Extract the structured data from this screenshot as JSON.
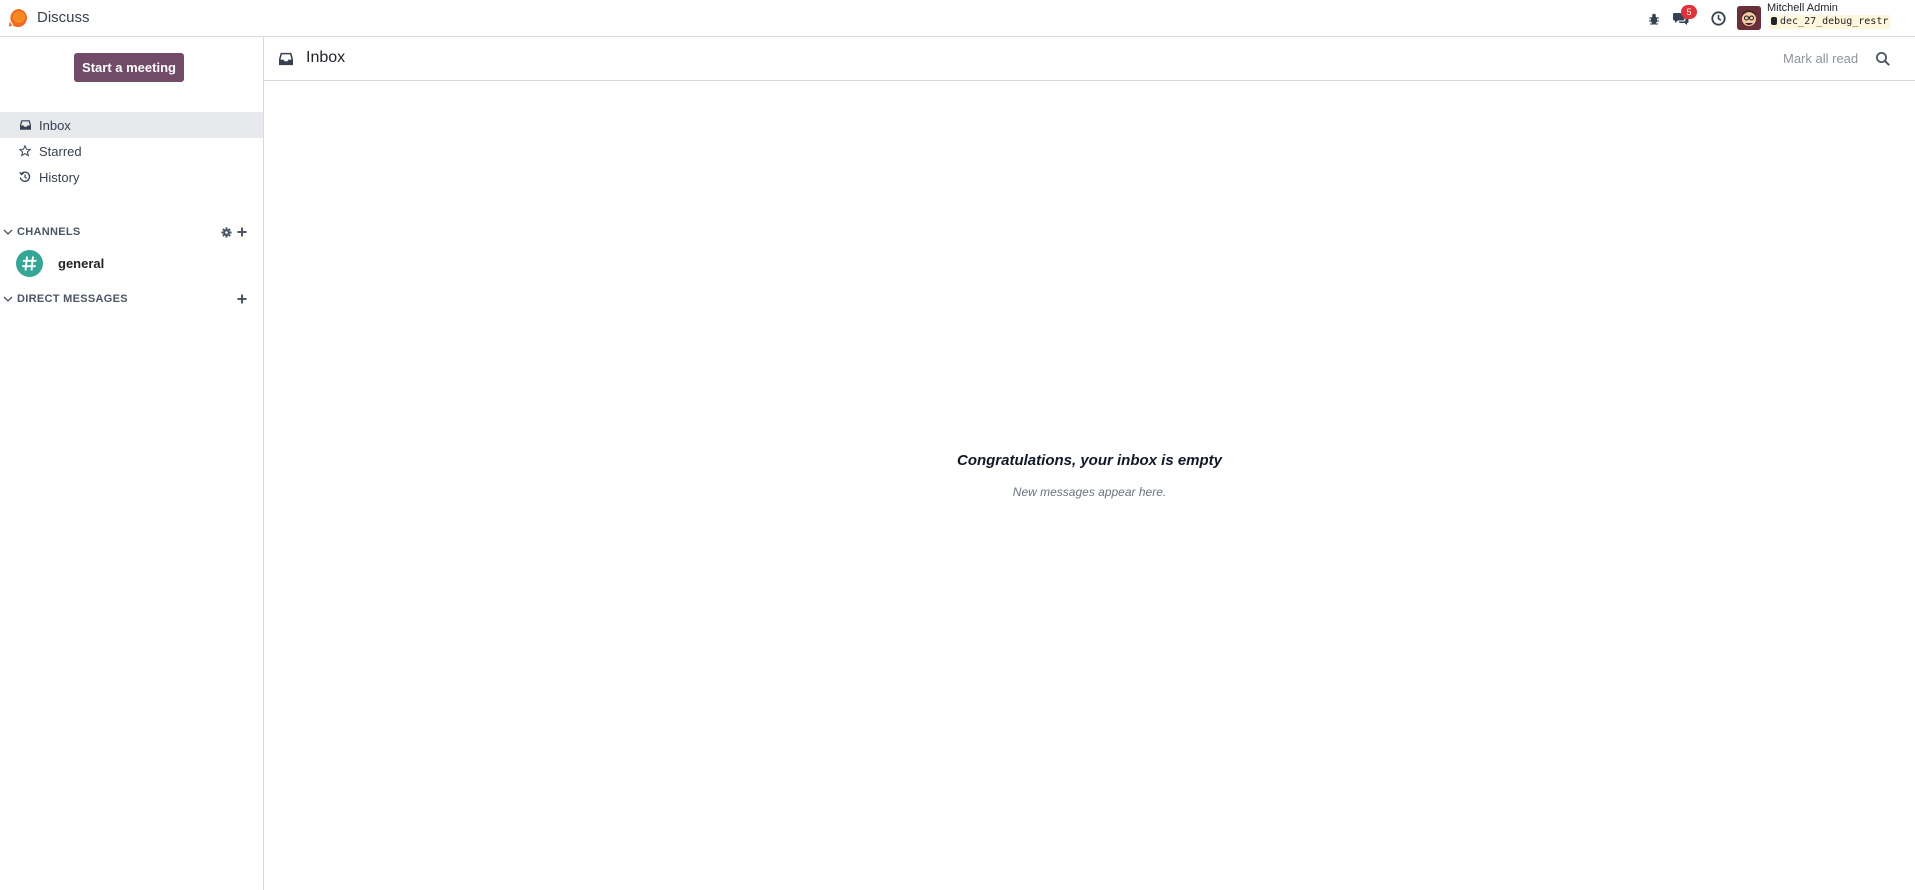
{
  "navbar": {
    "app_name": "Discuss",
    "app_logo_icon": "odoo-discuss-logo-icon",
    "messaging_badge": "5",
    "user_name": "Mitchell Admin",
    "database": "dec_27_debug_restr"
  },
  "sidebar": {
    "start_meeting_label": "Start a meeting",
    "mailboxes": [
      {
        "label": "Inbox",
        "icon": "inbox-icon",
        "active": true
      },
      {
        "label": "Starred",
        "icon": "star-icon",
        "active": false
      },
      {
        "label": "History",
        "icon": "history-icon",
        "active": false
      }
    ],
    "channels_header": "CHANNELS",
    "channels": [
      {
        "name": "general",
        "icon": "hashtag-icon"
      }
    ],
    "direct_messages_header": "DIRECT MESSAGES"
  },
  "main": {
    "title": "Inbox",
    "mark_all_read_label": "Mark all read",
    "empty_title": "Congratulations, your inbox is empty",
    "empty_subtitle": "New messages appear here."
  },
  "colors": {
    "brand": "#714b67",
    "active_item_bg": "#e7e9ed",
    "badge": "#e0323a",
    "channel_avatar": "#35a596",
    "logo_orange": "#f06a20"
  }
}
